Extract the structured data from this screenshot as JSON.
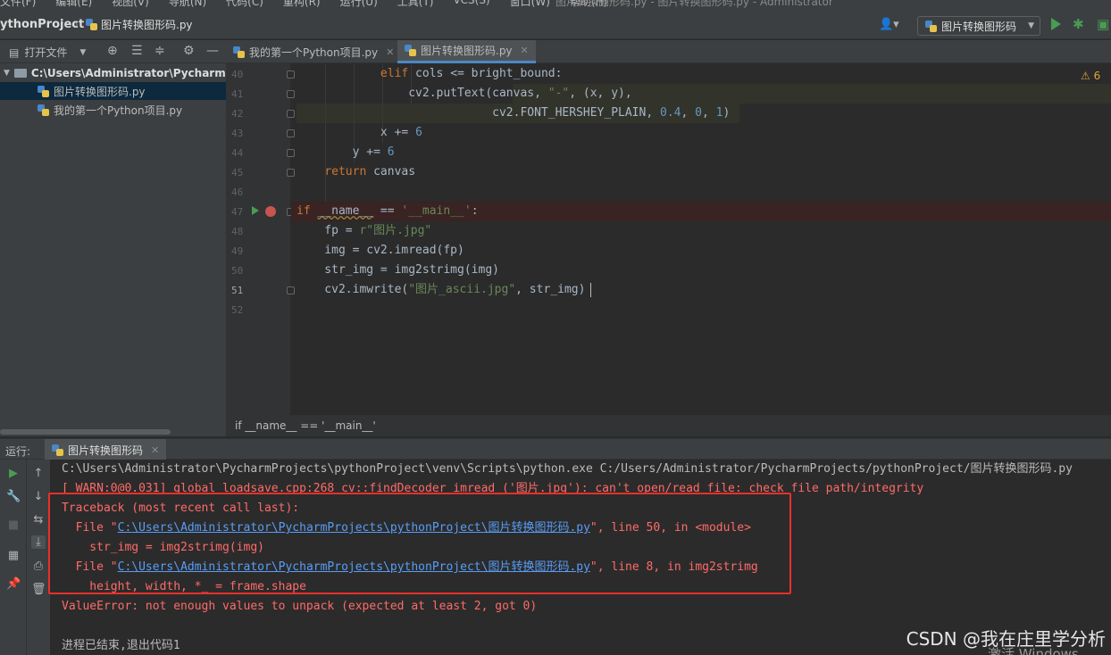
{
  "menubar": {
    "items": [
      "文件(F)",
      "编辑(E)",
      "视图(V)",
      "导航(N)",
      "代码(C)",
      "重构(R)",
      "运行(U)",
      "工具(T)",
      "VCS(S)",
      "窗口(W)",
      "帮助(H)"
    ],
    "window_title": "图片转换图形码.py - 图片转换图形码.py - Administrator"
  },
  "navbar": {
    "project": "ythonProject",
    "file": "图片转换图形码.py",
    "run_config": "图片转换图形码"
  },
  "project_panel": {
    "open_file_label": "打开文件",
    "root": "C:\\Users\\Administrator\\PycharmPr",
    "files": [
      "图片转换图形码.py",
      "我的第一个Python项目.py"
    ]
  },
  "editor": {
    "tabs": [
      {
        "label": "我的第一个Python项目.py",
        "active": false
      },
      {
        "label": "图片转换图形码.py",
        "active": true
      }
    ],
    "warnings": "6",
    "line_numbers": [
      "40",
      "41",
      "42",
      "43",
      "44",
      "45",
      "46",
      "47",
      "48",
      "49",
      "50",
      "51",
      "52"
    ],
    "lines": [
      [
        {
          "t": "            "
        },
        {
          "t": "elif",
          "c": "kw"
        },
        {
          "t": " cols <= bright_bound:"
        }
      ],
      [
        {
          "t": "                cv2.putText(canvas, "
        },
        {
          "t": "\"-\"",
          "c": "str"
        },
        {
          "t": ", (x, y),"
        }
      ],
      [
        {
          "t": "                            cv2.FONT_HERSHEY_PLAIN, "
        },
        {
          "t": "0.4",
          "c": "num"
        },
        {
          "t": ", "
        },
        {
          "t": "0",
          "c": "num"
        },
        {
          "t": ", "
        },
        {
          "t": "1",
          "c": "num"
        },
        {
          "t": ")"
        }
      ],
      [
        {
          "t": "            x += "
        },
        {
          "t": "6",
          "c": "num"
        }
      ],
      [
        {
          "t": "        y += "
        },
        {
          "t": "6",
          "c": "num"
        }
      ],
      [
        {
          "t": "    "
        },
        {
          "t": "return",
          "c": "kw"
        },
        {
          "t": " canvas"
        }
      ],
      [
        {
          "t": ""
        }
      ],
      [
        {
          "t": "if",
          "c": "kw"
        },
        {
          "t": " "
        },
        {
          "t": "__name__",
          "c": "dunder"
        },
        {
          "t": " == "
        },
        {
          "t": "'__main__'",
          "c": "str"
        },
        {
          "t": ":"
        }
      ],
      [
        {
          "t": "    fp = "
        },
        {
          "t": "r\"图片.jpg\"",
          "c": "str"
        }
      ],
      [
        {
          "t": "    img = cv2.imread(fp)"
        }
      ],
      [
        {
          "t": "    str_img = img2strimg(img)"
        }
      ],
      [
        {
          "t": "    cv2.imwrite("
        },
        {
          "t": "\"图片_ascii.jpg\"",
          "c": "str"
        },
        {
          "t": ", str_img)"
        }
      ],
      [
        {
          "t": ""
        }
      ]
    ],
    "breadcrumb": "if __name__ == '__main__'"
  },
  "run": {
    "label": "运行:",
    "tab": "图片转换图形码",
    "console": [
      {
        "text": "C:\\Users\\Administrator\\PycharmProjects\\pythonProject\\venv\\Scripts\\python.exe C:/Users/Administrator/PycharmProjects/pythonProject/图片转换图形码.py",
        "style": "normal"
      },
      {
        "text": "[ WARN:0@0.031] global loadsave.cpp:268 cv::findDecoder imread_('图片.jpg'): can't open/read file: check file path/integrity",
        "style": "err"
      },
      {
        "text": "Traceback (most recent call last):",
        "style": "err"
      },
      {
        "prefix": "  File \"",
        "link": "C:\\Users\\Administrator\\PycharmProjects\\pythonProject\\图片转换图形码.py",
        "suffix": "\", line 50, in <module>",
        "style": "err"
      },
      {
        "text": "    str_img = img2strimg(img)",
        "style": "err"
      },
      {
        "prefix": "  File \"",
        "link": "C:\\Users\\Administrator\\PycharmProjects\\pythonProject\\图片转换图形码.py",
        "suffix": "\", line 8, in img2strimg",
        "style": "err"
      },
      {
        "text": "    height, width, *_ = frame.shape",
        "style": "err"
      },
      {
        "text": "ValueError: not enough values to unpack (expected at least 2, got 0)",
        "style": "err"
      },
      {
        "text": "",
        "style": "normal"
      },
      {
        "text": "进程已结束,退出代码1",
        "style": "normal"
      }
    ]
  },
  "watermark": "CSDN @我在庄里学分析",
  "windows_activation": "激活 Windows",
  "colors": {
    "accent": "#4a88c7",
    "error": "#ff6b68",
    "highlight_box": "#e8302a",
    "run_green": "#499c54"
  }
}
